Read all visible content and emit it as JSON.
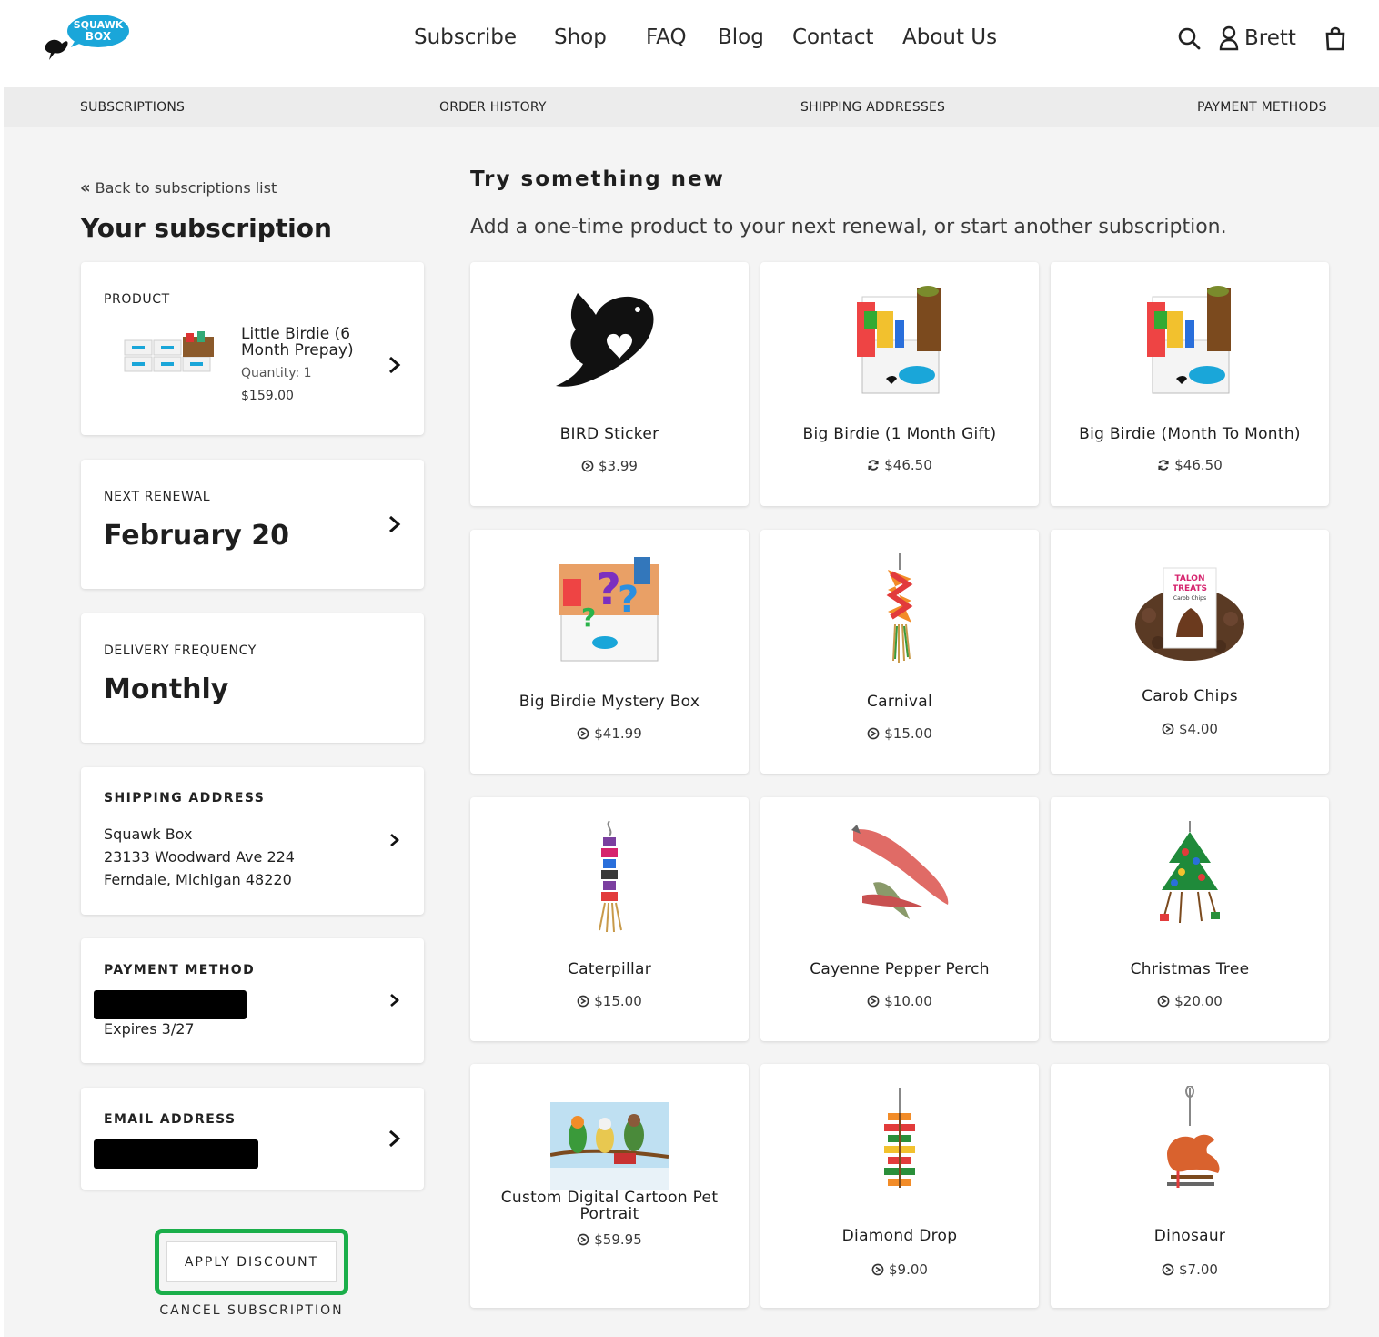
{
  "brand": {
    "logo_line1": "SQUAWK",
    "logo_line2": "BOX"
  },
  "nav": [
    "Subscribe",
    "Shop",
    "FAQ",
    "Blog",
    "Contact",
    "About Us"
  ],
  "user": {
    "name": "Brett"
  },
  "sub_nav": [
    "SUBSCRIPTIONS",
    "ORDER HISTORY",
    "SHIPPING ADDRESSES",
    "PAYMENT METHODS"
  ],
  "left": {
    "back_link": "Back to subscriptions list",
    "title": "Your subscription",
    "product": {
      "label": "PRODUCT",
      "name_line1": "Little Birdie (6",
      "name_line2": "Month Prepay)",
      "quantity": "Quantity: 1",
      "price": "$159.00"
    },
    "renewal": {
      "label": "NEXT RENEWAL",
      "value": "February 20"
    },
    "frequency": {
      "label": "DELIVERY FREQUENCY",
      "value": "Monthly"
    },
    "shipping": {
      "label": "SHIPPING ADDRESS",
      "line1": "Squawk Box",
      "line2": "23133 Woodward Ave 224",
      "line3": "Ferndale, Michigan 48220"
    },
    "payment": {
      "label": "PAYMENT METHOD",
      "expires": "Expires 3/27"
    },
    "email": {
      "label": "EMAIL ADDRESS"
    },
    "apply_discount": "APPLY DISCOUNT",
    "cancel": "CANCEL SUBSCRIPTION"
  },
  "right": {
    "title": "Try something new",
    "subtitle": "Add a one-time product to your next renewal, or start another subscription.",
    "products": [
      {
        "name": "BIRD Sticker",
        "price": "$3.99",
        "icon": "one-time-icon"
      },
      {
        "name": "Big Birdie (1 Month Gift)",
        "price": "$46.50",
        "icon": "recurring-icon"
      },
      {
        "name": "Big Birdie (Month To Month)",
        "price": "$46.50",
        "icon": "recurring-icon"
      },
      {
        "name": "Big Birdie Mystery Box",
        "price": "$41.99",
        "icon": "one-time-icon"
      },
      {
        "name": "Carnival",
        "price": "$15.00",
        "icon": "one-time-icon"
      },
      {
        "name": "Carob Chips",
        "price": "$4.00",
        "icon": "one-time-icon"
      },
      {
        "name": "Caterpillar",
        "price": "$15.00",
        "icon": "one-time-icon"
      },
      {
        "name": "Cayenne Pepper Perch",
        "price": "$10.00",
        "icon": "one-time-icon"
      },
      {
        "name": "Christmas Tree",
        "price": "$20.00",
        "icon": "one-time-icon"
      },
      {
        "name": "Custom Digital Cartoon Pet Portrait",
        "price": "$59.95",
        "icon": "one-time-icon"
      },
      {
        "name": "Diamond Drop",
        "price": "$9.00",
        "icon": "one-time-icon"
      },
      {
        "name": "Dinosaur",
        "price": "$7.00",
        "icon": "one-time-icon"
      }
    ],
    "carob_label_1": "TALON",
    "carob_label_2": "TREATS",
    "carob_label_3": "Carob Chips"
  },
  "colors": {
    "accent_green": "#1aae4a",
    "logo_blue": "#1aa6d9",
    "subnav_bg": "#ececec",
    "page_bg": "#f4f4f4"
  }
}
